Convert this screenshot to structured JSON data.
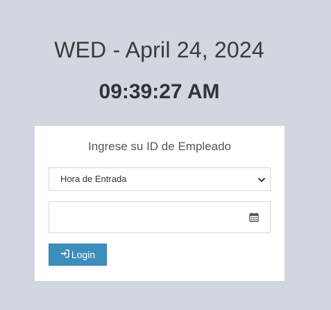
{
  "header": {
    "date": "WED - April 24, 2024",
    "time": "09:39:27 AM"
  },
  "login_box": {
    "title": "Ingrese su ID de Empleado",
    "select_value": "Hora de Entrada",
    "employee_id_value": "",
    "button_label": "Login"
  },
  "icons": {
    "select": "chevron-down-icon",
    "input": "calendar-icon",
    "button": "sign-in-icon"
  },
  "colors": {
    "background": "#d2d6de",
    "button": "#3c8dbc"
  }
}
